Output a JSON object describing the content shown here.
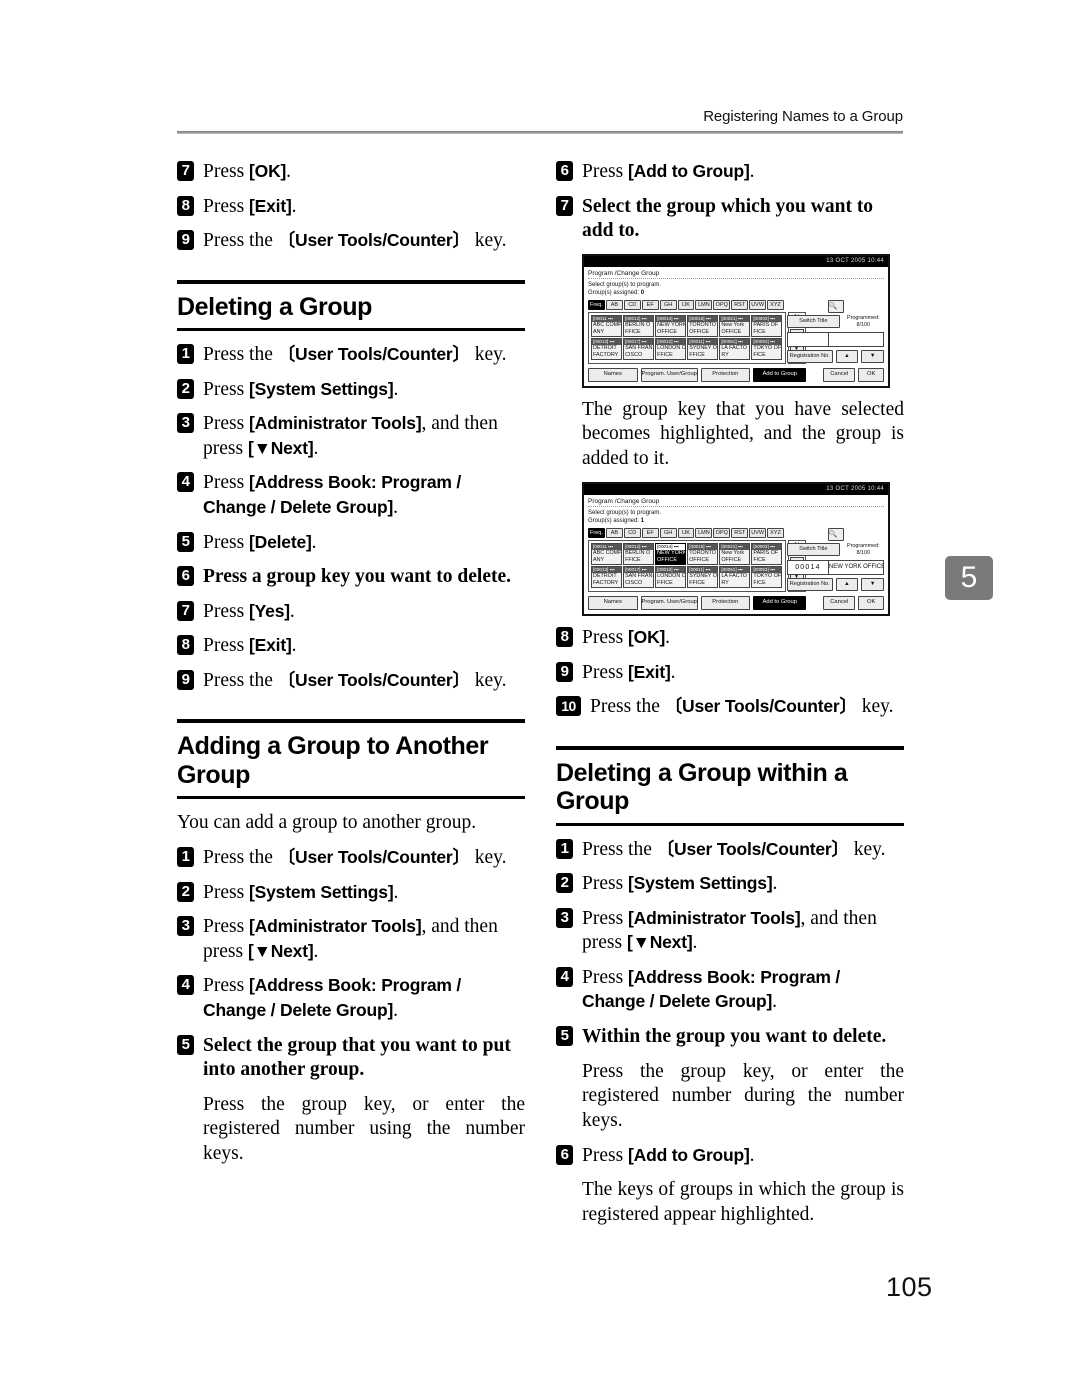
{
  "header": {
    "running_head": "Registering Names to a Group",
    "chapter_tab": "5",
    "page_number": "105"
  },
  "left_column": {
    "top_steps": [
      {
        "num": "7",
        "text_pre": "Press ",
        "key": "[OK]",
        "text_post": "."
      },
      {
        "num": "8",
        "text_pre": "Press ",
        "key": "[Exit]",
        "text_post": "."
      },
      {
        "num": "9",
        "text_pre": "Press the ",
        "key": "〔User Tools/Counter〕",
        "text_post": " key."
      }
    ],
    "section_deleting_group": {
      "title": "Deleting a Group",
      "steps": [
        {
          "num": "1",
          "text_pre": "Press the ",
          "key": "〔User Tools/Counter〕",
          "text_post": " key."
        },
        {
          "num": "2",
          "text_pre": "Press ",
          "key": "[System Settings]",
          "text_post": "."
        },
        {
          "num": "3",
          "text_pre": "Press ",
          "key": "[Administrator Tools]",
          "text_mid": ", and then press ",
          "key2": "[▼Next]",
          "text_post": "."
        },
        {
          "num": "4",
          "text_pre": "Press ",
          "key": "[Address Book: Program / Change / Delete Group]",
          "text_post": "."
        },
        {
          "num": "5",
          "text_pre": "Press ",
          "key": "[Delete]",
          "text_post": "."
        },
        {
          "num": "6",
          "bold_text": "Press a group key you want to delete."
        },
        {
          "num": "7",
          "text_pre": "Press ",
          "key": "[Yes]",
          "text_post": "."
        },
        {
          "num": "8",
          "text_pre": "Press ",
          "key": "[Exit]",
          "text_post": "."
        },
        {
          "num": "9",
          "text_pre": "Press the ",
          "key": "〔User Tools/Counter〕",
          "text_post": " key."
        }
      ]
    },
    "section_adding_group": {
      "title": "Adding a Group to Another Group",
      "intro": "You can add a group to another group.",
      "steps": [
        {
          "num": "1",
          "text_pre": "Press the ",
          "key": "〔User Tools/Counter〕",
          "text_post": " key."
        },
        {
          "num": "2",
          "text_pre": "Press ",
          "key": "[System Settings]",
          "text_post": "."
        },
        {
          "num": "3",
          "text_pre": "Press ",
          "key": "[Administrator Tools]",
          "text_mid": ", and then press ",
          "key2": "[▼Next]",
          "text_post": "."
        },
        {
          "num": "4",
          "text_pre": "Press ",
          "key": "[Address Book: Program / Change / Delete Group]",
          "text_post": "."
        },
        {
          "num": "5",
          "bold_text": "Select the group that you want to put into another group."
        }
      ],
      "note": "Press the group key, or enter the registered number using the number keys."
    }
  },
  "right_column": {
    "top_steps": [
      {
        "num": "6",
        "text_pre": "Press ",
        "key": "[Add to Group]",
        "text_post": "."
      },
      {
        "num": "7",
        "bold_text": "Select the group which you want to add to."
      }
    ],
    "note_after_screen1": "The group key that you have selected becomes highlighted, and the group is added to it.",
    "steps_after_screen2": [
      {
        "num": "8",
        "text_pre": "Press ",
        "key": "[OK]",
        "text_post": "."
      },
      {
        "num": "9",
        "text_pre": "Press ",
        "key": "[Exit]",
        "text_post": "."
      },
      {
        "num": "10",
        "text_pre": "Press the ",
        "key": "〔User Tools/Counter〕",
        "text_post": " key."
      }
    ],
    "section_deleting_within": {
      "title": "Deleting a Group within a Group",
      "steps": [
        {
          "num": "1",
          "text_pre": "Press the ",
          "key": "〔User Tools/Counter〕",
          "text_post": " key."
        },
        {
          "num": "2",
          "text_pre": "Press ",
          "key": "[System Settings]",
          "text_post": "."
        },
        {
          "num": "3",
          "text_pre": "Press ",
          "key": "[Administrator Tools]",
          "text_mid": ", and then press ",
          "key2": "[▼Next]",
          "text_post": "."
        },
        {
          "num": "4",
          "text_pre": "Press ",
          "key": "[Address Book: Program / Change / Delete Group]",
          "text_post": "."
        },
        {
          "num": "5",
          "bold_text": "Within the group you want to delete."
        }
      ],
      "note1": "Press the group key, or enter the registered number during the number keys.",
      "step6": {
        "num": "6",
        "text_pre": "Press ",
        "key": "[Add to Group]",
        "text_post": "."
      },
      "note2": "The keys of groups in which the group is registered appear highlighted."
    }
  },
  "lcd_screen_1": {
    "clock": "13 OCT 2005 10:44",
    "title": "Program /Change Group",
    "instruction": "Select group(s) to program.",
    "assigned_label": "Group(s) assigned:",
    "assigned_value": "0",
    "tabs": [
      "Freq.",
      "AB",
      "CD",
      "EF",
      "GH",
      "IJK",
      "LMN",
      "OPQ",
      "RST",
      "UVW",
      "XYZ"
    ],
    "selected_tab": "Freq.",
    "search_icon": "search-icon",
    "switch_title_label": "Switch Title",
    "programmed_label": "Programmed:",
    "programmed_value": "8/100",
    "page_indicator": "1/\n1",
    "reg_num": "",
    "reg_name": "",
    "registration_no_label": "Registration No.",
    "up_arrow": "▲",
    "down_arrow": "▼",
    "group_keys": [
      {
        "code": "[00011 ▪▪▪",
        "line1": "ABC COMP",
        "line2": "ANY",
        "highlighted": false
      },
      {
        "code": "[00012] ▪▪▪",
        "line1": "BERLIN O",
        "line2": "FFICE",
        "highlighted": false
      },
      {
        "code": "[00014] ▪▪▪",
        "line1": "NEW YORK",
        "line2": "OFFICE",
        "highlighted": false
      },
      {
        "code": "[00015] ▪▪▪",
        "line1": "TORONTO",
        "line2": "OFFICE",
        "highlighted": false
      },
      {
        "code": "[00021] ▪▪▪",
        "line1": "New York",
        "line2": "OFFICE",
        "highlighted": false
      },
      {
        "code": "[00003] ▪▪▪",
        "line1": "PARIS OF",
        "line2": "FICE",
        "highlighted": false
      },
      {
        "code": "[00013] ▪▪▪",
        "line1": "DETROIT",
        "line2": "FACTORY",
        "highlighted": false
      },
      {
        "code": "[00017] ▪▪▪",
        "line1": "SAN FRAN",
        "line2": "CISCO",
        "highlighted": false
      },
      {
        "code": "[00012] ▪▪▪",
        "line1": "LONDON O",
        "line2": "FFICE",
        "highlighted": false
      },
      {
        "code": "[00011] ▪▪▪",
        "line1": "SYDNEY O",
        "line2": "FFICE",
        "highlighted": false
      },
      {
        "code": "[00051] ▪▪▪",
        "line1": "LA FACTO",
        "line2": "RY",
        "highlighted": false
      },
      {
        "code": "[00053] ▪▪▪",
        "line1": "TOKYO OF",
        "line2": "FICE",
        "highlighted": false
      }
    ],
    "footer": {
      "names": "Names",
      "program_user_group": "Program. User/Group",
      "protection": "Protection",
      "add_to_group": "Add to Group",
      "cancel": "Cancel",
      "ok": "OK"
    }
  },
  "lcd_screen_2": {
    "clock": "13 OCT 2005 10:44",
    "title": "Program /Change Group",
    "instruction": "Select group(s) to program.",
    "assigned_label": "Group(s) assigned:",
    "assigned_value": "1",
    "tabs": [
      "Freq.",
      "AB",
      "CD",
      "EF",
      "GH",
      "IJK",
      "LMN",
      "OPQ",
      "RST",
      "UVW",
      "XYZ"
    ],
    "selected_tab": "Freq.",
    "search_icon": "search-icon",
    "switch_title_label": "Switch Title",
    "programmed_label": "Programmed:",
    "programmed_value": "8/100",
    "page_indicator": "1/\n1",
    "reg_num": "00014",
    "reg_name": "NEW YORK OFFICE",
    "registration_no_label": "Registration No.",
    "up_arrow": "▲",
    "down_arrow": "▼",
    "group_keys": [
      {
        "code": "[00011 ▪▪▪",
        "line1": "ABC COMP",
        "line2": "ANY",
        "highlighted": false
      },
      {
        "code": "[00012] ▪▪▪",
        "line1": "BERLIN O",
        "line2": "FFICE",
        "highlighted": false
      },
      {
        "code": "[00014] ▪▪▪",
        "line1": "NEW YORK",
        "line2": "OFFICE",
        "highlighted": true
      },
      {
        "code": "[00015] ▪▪▪",
        "line1": "TORONTO",
        "line2": "OFFICE",
        "highlighted": false
      },
      {
        "code": "[00021] ▪▪▪",
        "line1": "New York",
        "line2": "OFFICE",
        "highlighted": false
      },
      {
        "code": "[00003] ▪▪▪",
        "line1": "PARIS OF",
        "line2": "FICE",
        "highlighted": false
      },
      {
        "code": "[00013] ▪▪▪",
        "line1": "DETROIT",
        "line2": "FACTORY",
        "highlighted": false
      },
      {
        "code": "[00017] ▪▪▪",
        "line1": "SAN FRAN",
        "line2": "CISCO",
        "highlighted": false
      },
      {
        "code": "[00012] ▪▪▪",
        "line1": "LONDON O",
        "line2": "FFICE",
        "highlighted": false
      },
      {
        "code": "[00011] ▪▪▪",
        "line1": "SYDNEY O",
        "line2": "FFICE",
        "highlighted": false
      },
      {
        "code": "[00051] ▪▪▪",
        "line1": "LA FACTO",
        "line2": "RY",
        "highlighted": false
      },
      {
        "code": "[00053] ▪▪▪",
        "line1": "TOKYO OF",
        "line2": "FICE",
        "highlighted": false
      }
    ],
    "footer": {
      "names": "Names",
      "program_user_group": "Program. User/Group",
      "protection": "Protection",
      "add_to_group": "Add to Group",
      "cancel": "Cancel",
      "ok": "OK"
    }
  }
}
